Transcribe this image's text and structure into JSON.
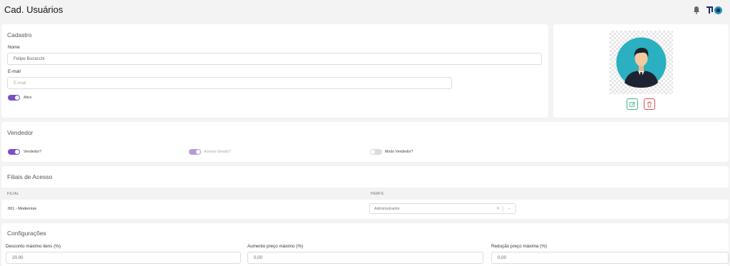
{
  "header": {
    "title": "Cad. Usuários",
    "icons": [
      "bell-icon",
      "company-logo"
    ]
  },
  "cadastro": {
    "title": "Cadastro",
    "nome_label": "Nome",
    "nome_value": "Felipe Buzacchi",
    "email_label": "E-mail",
    "email_placeholder": "E-mail",
    "ativo_label": "Ativo",
    "ativo": true
  },
  "photo": {
    "edit_icon": "edit-icon",
    "delete_icon": "trash-icon"
  },
  "vendedor": {
    "title": "Vendedor",
    "toggles": [
      {
        "label": "Vendedor?",
        "state": "on"
      },
      {
        "label": "Acessa Gestão?",
        "state": "on-disabled"
      },
      {
        "label": "Modo Vendedor?",
        "state": "off"
      }
    ]
  },
  "filiais": {
    "title": "Filiais de Acesso",
    "columns": [
      "FILIAL",
      "PERFIL"
    ],
    "rows": [
      {
        "filial": "001 - Modernize",
        "perfil": "Administrador"
      }
    ]
  },
  "config": {
    "title": "Configurações",
    "fields": [
      {
        "label": "Desconto máximo itens (%)",
        "value": "20,00"
      },
      {
        "label": "Aumento preço máximo (%)",
        "value": "0,00"
      },
      {
        "label": "Redução preço máxima (%)",
        "value": "0,00"
      }
    ]
  },
  "colors": {
    "accent": "#7b4fc4",
    "success": "#3fb57a",
    "danger": "#d9534f",
    "logo_teal": "#1a9bb0",
    "logo_navy": "#1b2a6b"
  }
}
